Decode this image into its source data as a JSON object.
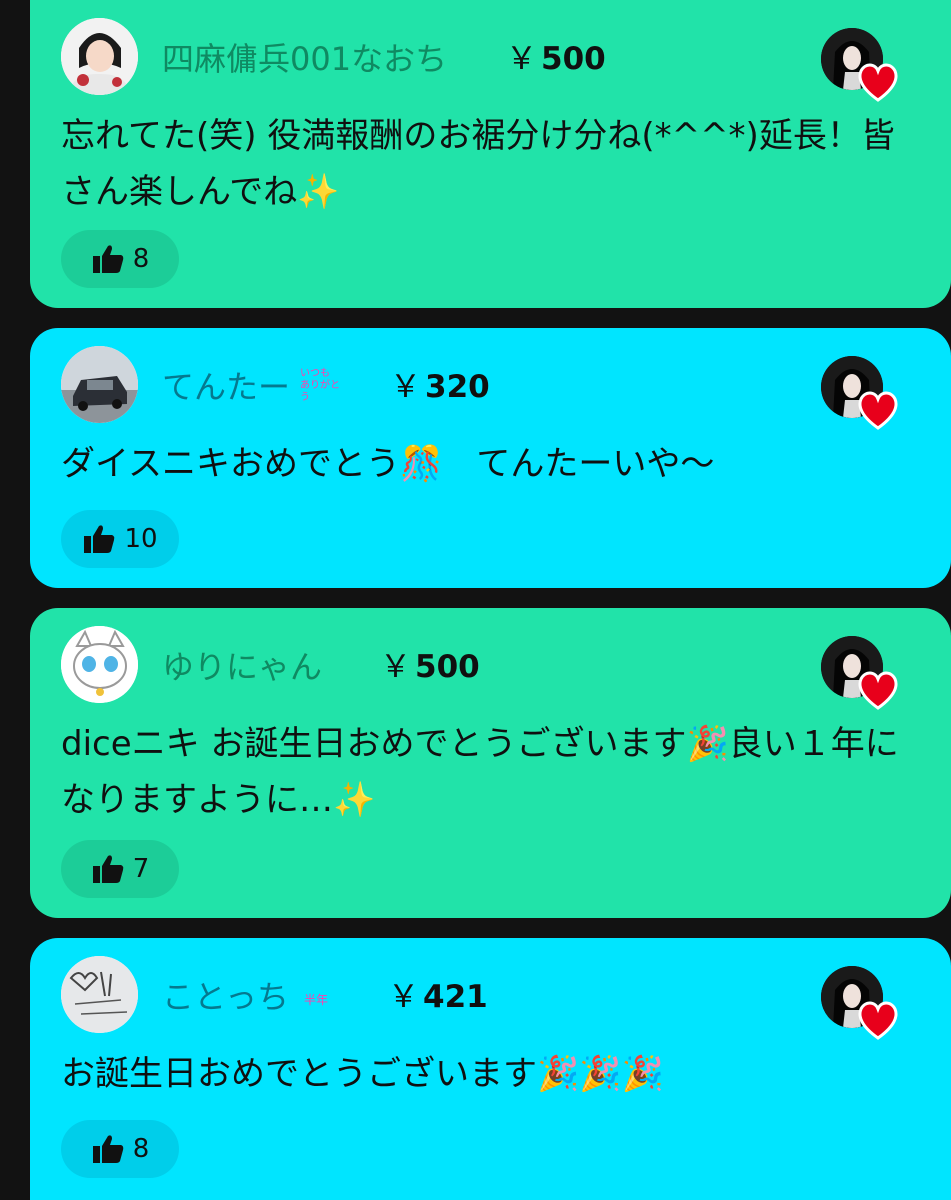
{
  "comments": [
    {
      "username": "四麻傭兵001なおち",
      "tag": "",
      "amount": "500",
      "currency": "￥",
      "message": "忘れてた(笑) 役満報酬のお裾分け分ね(*^^*)延長！皆さん楽しんでね✨",
      "likes": "8",
      "color": "#21e3a9"
    },
    {
      "username": "てんたー",
      "tag": "いつも ありがとう",
      "amount": "320",
      "currency": "￥",
      "message": "ダイスニキおめでとう🎊　てんたーいや〜",
      "likes": "10",
      "color": "#00e5ff"
    },
    {
      "username": "ゆりにゃん",
      "tag": "",
      "amount": "500",
      "currency": "￥",
      "message": "diceニキ お誕生日おめでとうございます🎉良い１年になりますように…✨",
      "likes": "7",
      "color": "#21e3a9"
    },
    {
      "username": "ことっち",
      "tag": "半年",
      "amount": "421",
      "currency": "￥",
      "message": "お誕生日おめでとうございます🎉🎉🎉",
      "likes": "8",
      "color": "#00e5ff"
    }
  ],
  "icons": {
    "like": "thumbs-up-icon",
    "host_heart": "heart-icon"
  }
}
